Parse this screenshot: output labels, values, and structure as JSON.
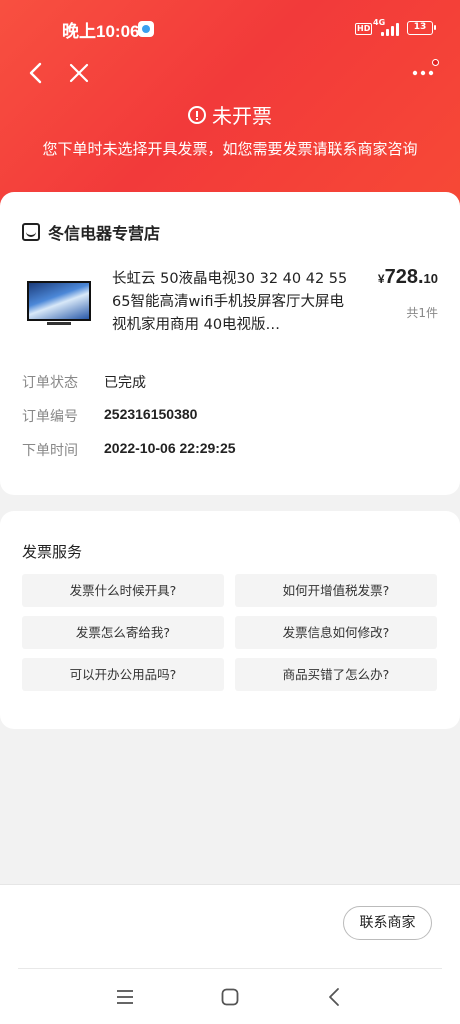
{
  "status_bar": {
    "time": "晚上10:06",
    "hd_label": "HD",
    "network": "4G",
    "battery": "13"
  },
  "header": {
    "title": "未开票",
    "subtitle": "您下单时未选择开具发票，如您需要发票请联系商家咨询",
    "background_color": "#f23a3a"
  },
  "order": {
    "store_name": "冬信电器专营店",
    "product_title": "长虹云 50液晶电视30 32 40 42 55 65智能高清wifi手机投屏客厅大屏电视机家用商用 40电视版…",
    "price_symbol": "¥",
    "price_int": "728.",
    "price_dec": "10",
    "quantity": "共1件",
    "rows": [
      {
        "label": "订单状态",
        "value": "已完成"
      },
      {
        "label": "订单编号",
        "value": "252316150380"
      },
      {
        "label": "下单时间",
        "value": "2022-10-06 22:29:25"
      }
    ]
  },
  "invoice_service": {
    "title": "发票服务",
    "questions": [
      "发票什么时候开具?",
      "如何开增值税发票?",
      "发票怎么寄给我?",
      "发票信息如何修改?",
      "可以开办公用品吗?",
      "商品买错了怎么办?"
    ]
  },
  "bottom": {
    "contact_label": "联系商家"
  },
  "icons": [
    "back-icon",
    "close-icon",
    "more-icon",
    "info-icon",
    "store-icon",
    "menu-icon",
    "home-icon",
    "nav-back-icon"
  ]
}
